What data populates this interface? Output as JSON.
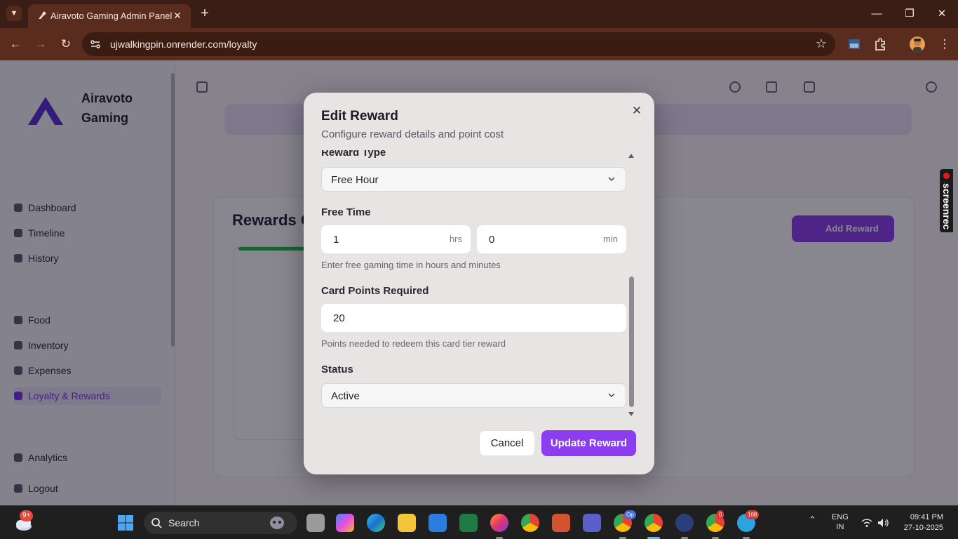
{
  "browser": {
    "tab_title": "Airavoto Gaming Admin Panel",
    "url": "ujwalkingpin.onrender.com/loyalty"
  },
  "app": {
    "brand_line1": "Airavoto",
    "brand_line2": "Gaming",
    "sidebar": [
      {
        "label": "Dashboard"
      },
      {
        "label": "Timeline"
      },
      {
        "label": "History"
      },
      {
        "label": "Food"
      },
      {
        "label": "Inventory"
      },
      {
        "label": "Expenses"
      },
      {
        "label": "Loyalty & Rewards"
      },
      {
        "label": "Analytics"
      },
      {
        "label": "Logout"
      }
    ],
    "card_title": "Rewards Card",
    "add_button": "Add Reward"
  },
  "modal": {
    "title": "Edit Reward",
    "subtitle": "Configure reward details and point cost",
    "reward_type_label": "Reward Type",
    "reward_type_value": "Free Hour",
    "free_time_label": "Free Time",
    "hours_value": "1",
    "hours_unit": "hrs",
    "minutes_value": "0",
    "minutes_unit": "min",
    "free_time_help": "Enter free gaming time in hours and minutes",
    "points_label": "Card Points Required",
    "points_value": "20",
    "points_help": "Points needed to redeem this card tier reward",
    "status_label": "Status",
    "status_value": "Active",
    "cancel_label": "Cancel",
    "update_label": "Update Reward"
  },
  "screenrec_label": "screenrec",
  "taskbar": {
    "weather_badge": "9+",
    "search_placeholder": "Search",
    "lang_line1": "ENG",
    "lang_line2": "IN",
    "time": "09:41 PM",
    "date": "27-10-2025",
    "chrome_badge_op": "Op",
    "chrome_badge_zero": "0",
    "telegram_badge": "108"
  },
  "colors": {
    "accent": "#8b3df0",
    "modal_bg": "#e7e4e4",
    "chrome_frame": "#3a1d14"
  }
}
